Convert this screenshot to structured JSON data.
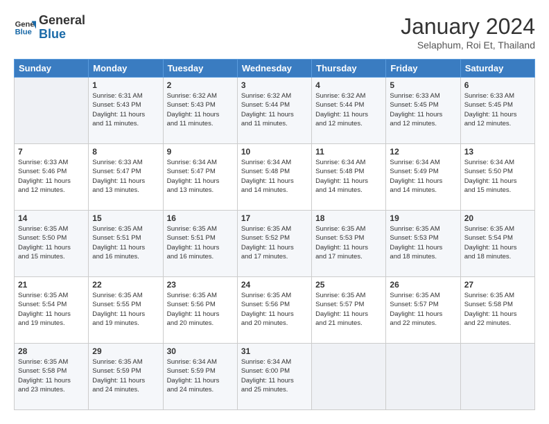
{
  "logo": {
    "line1": "General",
    "line2": "Blue"
  },
  "title": "January 2024",
  "subtitle": "Selaphum, Roi Et, Thailand",
  "days_of_week": [
    "Sunday",
    "Monday",
    "Tuesday",
    "Wednesday",
    "Thursday",
    "Friday",
    "Saturday"
  ],
  "weeks": [
    [
      {
        "day": "",
        "info": ""
      },
      {
        "day": "1",
        "info": "Sunrise: 6:31 AM\nSunset: 5:43 PM\nDaylight: 11 hours\nand 11 minutes."
      },
      {
        "day": "2",
        "info": "Sunrise: 6:32 AM\nSunset: 5:43 PM\nDaylight: 11 hours\nand 11 minutes."
      },
      {
        "day": "3",
        "info": "Sunrise: 6:32 AM\nSunset: 5:44 PM\nDaylight: 11 hours\nand 11 minutes."
      },
      {
        "day": "4",
        "info": "Sunrise: 6:32 AM\nSunset: 5:44 PM\nDaylight: 11 hours\nand 12 minutes."
      },
      {
        "day": "5",
        "info": "Sunrise: 6:33 AM\nSunset: 5:45 PM\nDaylight: 11 hours\nand 12 minutes."
      },
      {
        "day": "6",
        "info": "Sunrise: 6:33 AM\nSunset: 5:45 PM\nDaylight: 11 hours\nand 12 minutes."
      }
    ],
    [
      {
        "day": "7",
        "info": "Sunrise: 6:33 AM\nSunset: 5:46 PM\nDaylight: 11 hours\nand 12 minutes."
      },
      {
        "day": "8",
        "info": "Sunrise: 6:33 AM\nSunset: 5:47 PM\nDaylight: 11 hours\nand 13 minutes."
      },
      {
        "day": "9",
        "info": "Sunrise: 6:34 AM\nSunset: 5:47 PM\nDaylight: 11 hours\nand 13 minutes."
      },
      {
        "day": "10",
        "info": "Sunrise: 6:34 AM\nSunset: 5:48 PM\nDaylight: 11 hours\nand 14 minutes."
      },
      {
        "day": "11",
        "info": "Sunrise: 6:34 AM\nSunset: 5:48 PM\nDaylight: 11 hours\nand 14 minutes."
      },
      {
        "day": "12",
        "info": "Sunrise: 6:34 AM\nSunset: 5:49 PM\nDaylight: 11 hours\nand 14 minutes."
      },
      {
        "day": "13",
        "info": "Sunrise: 6:34 AM\nSunset: 5:50 PM\nDaylight: 11 hours\nand 15 minutes."
      }
    ],
    [
      {
        "day": "14",
        "info": "Sunrise: 6:35 AM\nSunset: 5:50 PM\nDaylight: 11 hours\nand 15 minutes."
      },
      {
        "day": "15",
        "info": "Sunrise: 6:35 AM\nSunset: 5:51 PM\nDaylight: 11 hours\nand 16 minutes."
      },
      {
        "day": "16",
        "info": "Sunrise: 6:35 AM\nSunset: 5:51 PM\nDaylight: 11 hours\nand 16 minutes."
      },
      {
        "day": "17",
        "info": "Sunrise: 6:35 AM\nSunset: 5:52 PM\nDaylight: 11 hours\nand 17 minutes."
      },
      {
        "day": "18",
        "info": "Sunrise: 6:35 AM\nSunset: 5:53 PM\nDaylight: 11 hours\nand 17 minutes."
      },
      {
        "day": "19",
        "info": "Sunrise: 6:35 AM\nSunset: 5:53 PM\nDaylight: 11 hours\nand 18 minutes."
      },
      {
        "day": "20",
        "info": "Sunrise: 6:35 AM\nSunset: 5:54 PM\nDaylight: 11 hours\nand 18 minutes."
      }
    ],
    [
      {
        "day": "21",
        "info": "Sunrise: 6:35 AM\nSunset: 5:54 PM\nDaylight: 11 hours\nand 19 minutes."
      },
      {
        "day": "22",
        "info": "Sunrise: 6:35 AM\nSunset: 5:55 PM\nDaylight: 11 hours\nand 19 minutes."
      },
      {
        "day": "23",
        "info": "Sunrise: 6:35 AM\nSunset: 5:56 PM\nDaylight: 11 hours\nand 20 minutes."
      },
      {
        "day": "24",
        "info": "Sunrise: 6:35 AM\nSunset: 5:56 PM\nDaylight: 11 hours\nand 20 minutes."
      },
      {
        "day": "25",
        "info": "Sunrise: 6:35 AM\nSunset: 5:57 PM\nDaylight: 11 hours\nand 21 minutes."
      },
      {
        "day": "26",
        "info": "Sunrise: 6:35 AM\nSunset: 5:57 PM\nDaylight: 11 hours\nand 22 minutes."
      },
      {
        "day": "27",
        "info": "Sunrise: 6:35 AM\nSunset: 5:58 PM\nDaylight: 11 hours\nand 22 minutes."
      }
    ],
    [
      {
        "day": "28",
        "info": "Sunrise: 6:35 AM\nSunset: 5:58 PM\nDaylight: 11 hours\nand 23 minutes."
      },
      {
        "day": "29",
        "info": "Sunrise: 6:35 AM\nSunset: 5:59 PM\nDaylight: 11 hours\nand 24 minutes."
      },
      {
        "day": "30",
        "info": "Sunrise: 6:34 AM\nSunset: 5:59 PM\nDaylight: 11 hours\nand 24 minutes."
      },
      {
        "day": "31",
        "info": "Sunrise: 6:34 AM\nSunset: 6:00 PM\nDaylight: 11 hours\nand 25 minutes."
      },
      {
        "day": "",
        "info": ""
      },
      {
        "day": "",
        "info": ""
      },
      {
        "day": "",
        "info": ""
      }
    ]
  ]
}
